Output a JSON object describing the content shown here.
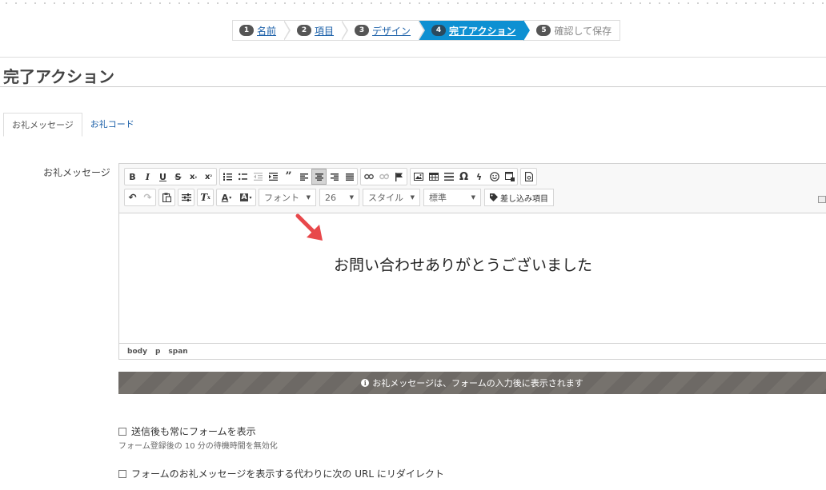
{
  "wizard": {
    "steps": [
      {
        "num": "1",
        "label": "名前"
      },
      {
        "num": "2",
        "label": "項目"
      },
      {
        "num": "3",
        "label": "デザイン"
      },
      {
        "num": "4",
        "label": "完了アクション"
      },
      {
        "num": "5",
        "label": "確認して保存"
      }
    ]
  },
  "page": {
    "title": "完了アクション"
  },
  "tabs": [
    {
      "label": "お礼メッセージ"
    },
    {
      "label": "お礼コード"
    }
  ],
  "form": {
    "field_label": "お礼メッセージ",
    "toolbar": {
      "font_select": "フォント",
      "size_select": "26",
      "style_select": "スタイル",
      "format_select": "標準",
      "insert_field": "差し込み項目"
    },
    "content_text": "お問い合わせありがとうございました",
    "status_path": [
      "body",
      "p",
      "span"
    ],
    "info_message": "お礼メッセージは、フォームの入力後に表示されます",
    "options": {
      "always_show_form": "送信後も常にフォームを表示",
      "always_show_hint": "フォーム登録後の 10 分の待機時間を無効化",
      "redirect": "フォームのお礼メッセージを表示する代わりに次の URL にリダイレクト"
    }
  },
  "colors": {
    "active_step": "#0e90d2",
    "link": "#1a5fa8",
    "arrow": "#e8484b",
    "info_bar": "#6d6965"
  }
}
